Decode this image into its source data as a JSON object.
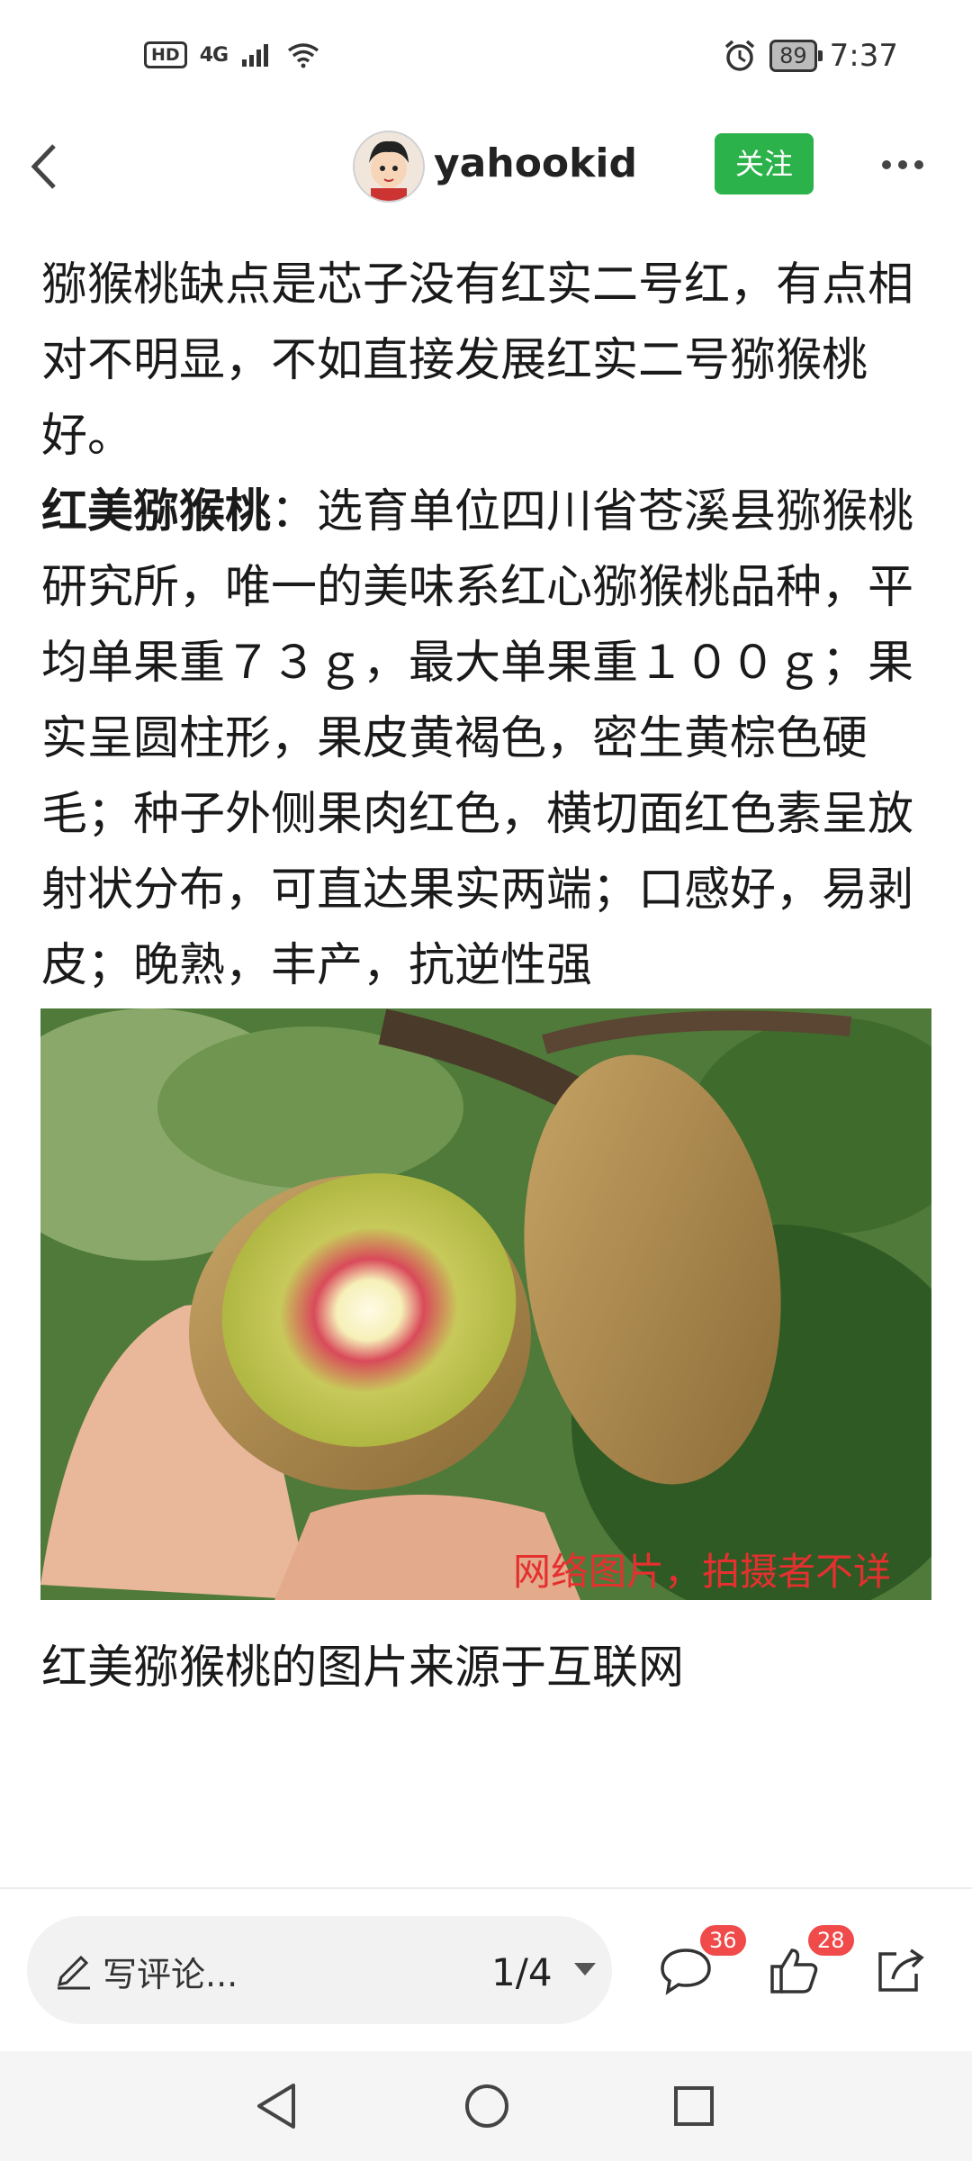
{
  "status_bar": {
    "hd": "HD",
    "network": "4G",
    "battery": "89",
    "time": "7:37"
  },
  "header": {
    "username": "yahookid",
    "follow_label": "关注"
  },
  "article": {
    "p1": "猕猴桃缺点是芯子没有红实二号红，有点相对不明显，不如直接发展红实二号猕猴桃好。",
    "p2_title": "红美猕猴桃",
    "p2_body": "：选育单位四川省苍溪县猕猴桃研究所，唯一的美味系红心猕猴桃品种，平均单果重７３ｇ，最大单果重１００ｇ；果实呈圆柱形，果皮黄褐色，密生黄棕色硬毛；种子外侧果肉红色，横切面红色素呈放射状分布，可直达果实两端；口感好，易剥皮；晚熟，丰产，抗逆性强",
    "image_watermark": "网络图片，拍摄者不详",
    "caption": "红美猕猴桃的图片来源于互联网"
  },
  "bottom_bar": {
    "comment_placeholder": "写评论...",
    "page_indicator": "1/4",
    "comment_count": "36",
    "like_count": "28"
  }
}
